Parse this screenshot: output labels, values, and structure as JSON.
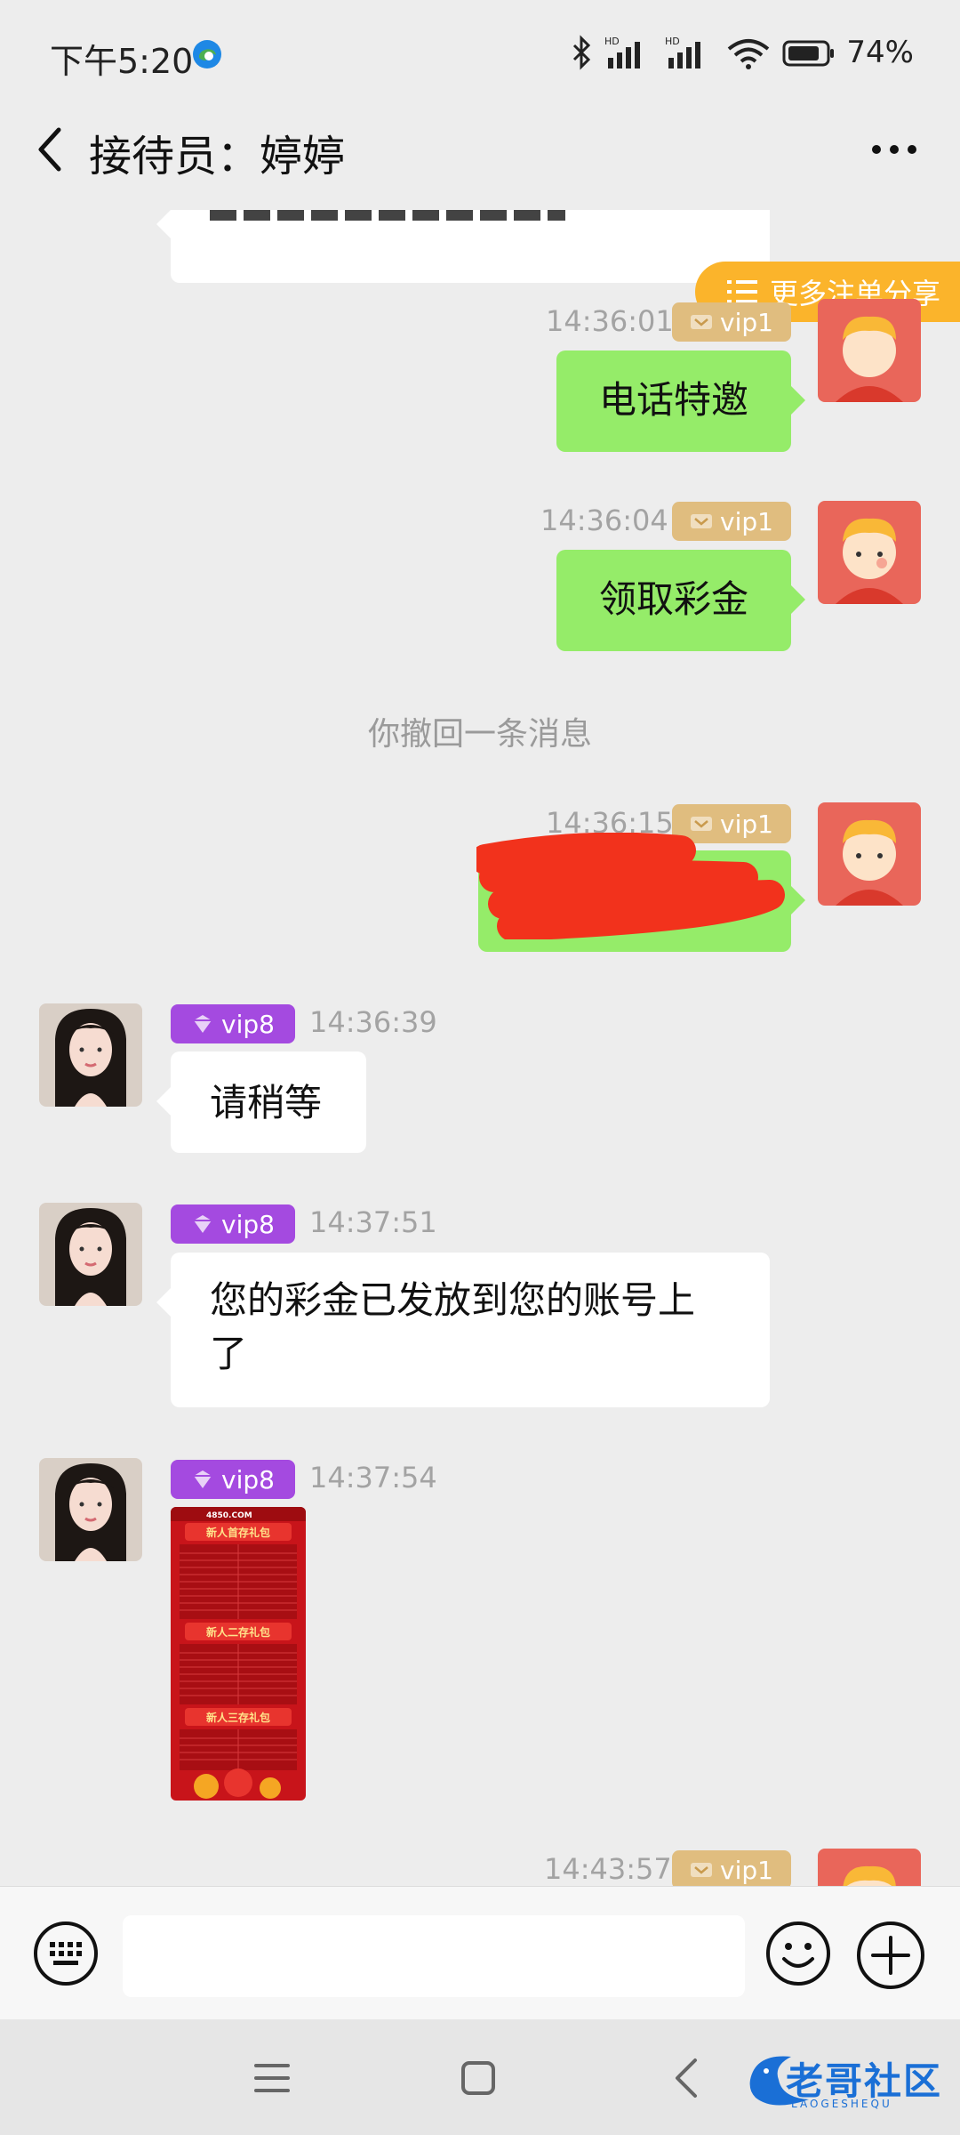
{
  "status_bar": {
    "time": "下午5:20",
    "battery": "74%"
  },
  "header": {
    "title": "接待员：婷婷"
  },
  "share_pill": {
    "label": "更多注单分享"
  },
  "messages": [
    {
      "side": "right",
      "time": "14:36:01",
      "badge": "vip1",
      "text": "电话特邀"
    },
    {
      "side": "right",
      "time": "14:36:04",
      "badge": "vip1",
      "text": "领取彩金"
    },
    {
      "type": "system",
      "text": "你撤回一条消息"
    },
    {
      "side": "right",
      "time": "14:36:15",
      "badge": "vip1",
      "text": ""
    },
    {
      "side": "left",
      "time": "14:36:39",
      "badge": "vip8",
      "text": "请稍等"
    },
    {
      "side": "left",
      "time": "14:37:51",
      "badge": "vip8",
      "text": "您的彩金已发放到您的账号上了"
    },
    {
      "side": "left",
      "time": "14:37:54",
      "badge": "vip8",
      "image": "promo-image"
    },
    {
      "side": "right",
      "time": "14:43:57",
      "badge": "vip1"
    }
  ],
  "promo_image": {
    "site": "4850.COM",
    "sections": [
      "新人首存礼包",
      "新人二存礼包",
      "新人三存礼包"
    ]
  },
  "input": {
    "placeholder": ""
  },
  "watermark": {
    "text": "老哥社区",
    "sub": "LAOGESHEQU"
  },
  "colors": {
    "background": "#ededed",
    "sent_bubble": "#95ec69",
    "received_bubble": "#ffffff",
    "vip1_badge": "#e0bd7f",
    "vip8_badge": "#a44ae0",
    "share_pill": "#fbb42b"
  }
}
